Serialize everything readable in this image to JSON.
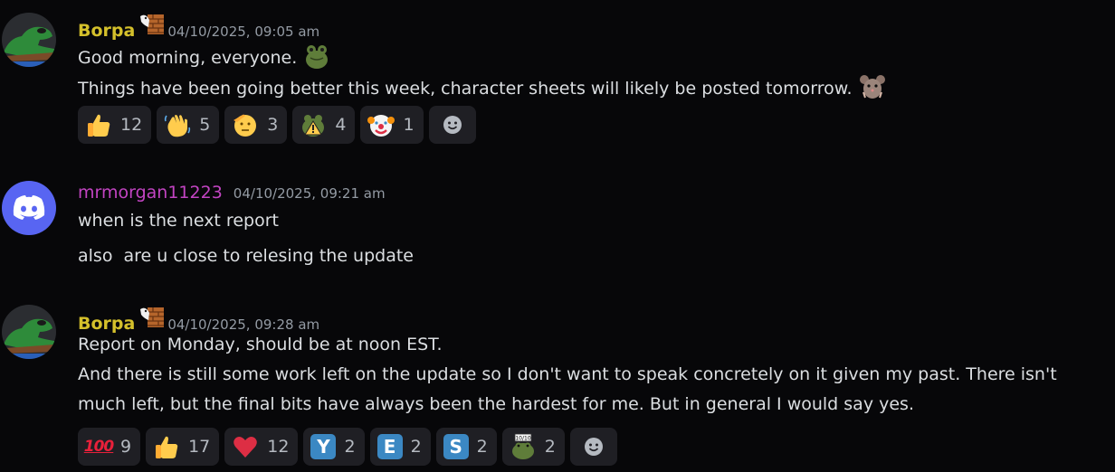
{
  "colors": {
    "background": "#070709",
    "borpa_name": "#d4c02b",
    "mrmorgan_name": "#c244c2",
    "timestamp": "#949ba4",
    "text": "#dbdee1",
    "reaction_bg": "#1f1f24",
    "discord_blurple": "#5865f2"
  },
  "messages": [
    {
      "author": "Borpa",
      "avatar": "frog-avatar",
      "role_icon": "wall-bird-icon",
      "timestamp": "04/10/2025, 09:05 am",
      "lines": [
        "Good morning, everyone.",
        "Things have been going better this week, character sheets will likely be posted tomorrow."
      ],
      "inline_emoji": [
        "frog-emoji",
        "rat-emoji"
      ],
      "reactions": [
        {
          "emoji": "thumbs-up-icon",
          "count": "12"
        },
        {
          "emoji": "waving-hand-icon",
          "count": "5"
        },
        {
          "emoji": "saluting-face-icon",
          "count": "3"
        },
        {
          "emoji": "frog-warning-icon",
          "count": "4"
        },
        {
          "emoji": "clown-face-icon",
          "count": "1"
        }
      ]
    },
    {
      "author": "mrmorgan11223",
      "avatar": "discord-logo-avatar",
      "timestamp": "04/10/2025, 09:21 am",
      "lines": [
        "when is the next report",
        "also  are u close to relesing the update"
      ]
    },
    {
      "author": "Borpa",
      "avatar": "frog-avatar",
      "role_icon": "wall-bird-icon",
      "timestamp": "04/10/2025, 09:28 am",
      "lines": [
        "Report on Monday, should be at noon EST.",
        "And there is still some work left on the update so I don't want to speak concretely on it given my past. There isn't",
        "much left, but the final bits have always been the hardest for me. But in general I would say yes."
      ],
      "reactions": [
        {
          "emoji": "hundred-points-icon",
          "label": "100",
          "count": "9"
        },
        {
          "emoji": "thumbs-up-icon",
          "count": "17"
        },
        {
          "emoji": "red-heart-icon",
          "count": "12"
        },
        {
          "emoji": "letter-y-icon",
          "label": "Y",
          "count": "2"
        },
        {
          "emoji": "letter-e-icon",
          "label": "E",
          "count": "2"
        },
        {
          "emoji": "letter-s-icon",
          "label": "S",
          "count": "2"
        },
        {
          "emoji": "frog-ten-icon",
          "label": "10/10",
          "count": "2"
        }
      ]
    }
  ]
}
